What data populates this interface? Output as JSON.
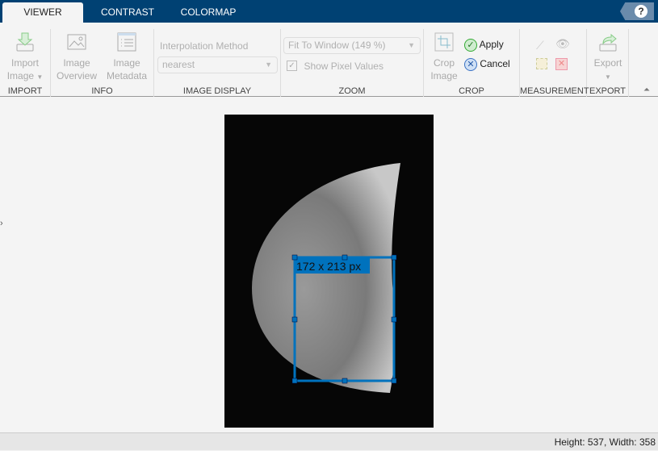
{
  "tabs": [
    {
      "label": "VIEWER",
      "active": true
    },
    {
      "label": "CONTRAST"
    },
    {
      "label": "COLORMAP"
    }
  ],
  "help_icon": "question-icon",
  "import": {
    "button": "Import",
    "button2": "Image",
    "section": "IMPORT"
  },
  "info": {
    "overview": [
      "Image",
      "Overview"
    ],
    "metadata": [
      "Image",
      "Metadata"
    ],
    "section": "INFO"
  },
  "display": {
    "interp_label": "Interpolation Method",
    "interp_value": "nearest",
    "section": "IMAGE DISPLAY"
  },
  "zoom": {
    "value": "Fit To Window (149 %)",
    "show_pixels": "Show Pixel Values",
    "show_pixels_checked": true,
    "section": "ZOOM"
  },
  "crop": {
    "crop_image": [
      "Crop",
      "Image"
    ],
    "apply": "Apply",
    "cancel": "Cancel",
    "section": "CROP"
  },
  "measurement": {
    "section": "MEASUREMENT"
  },
  "export": {
    "button": "Export",
    "section": "EXPORT"
  },
  "image": {
    "crop_size_label": "172 x 213 px"
  },
  "status": {
    "text": "Height: 537, Width: 358"
  },
  "colors": {
    "accent": "#004173",
    "crop": "#0072bd"
  }
}
